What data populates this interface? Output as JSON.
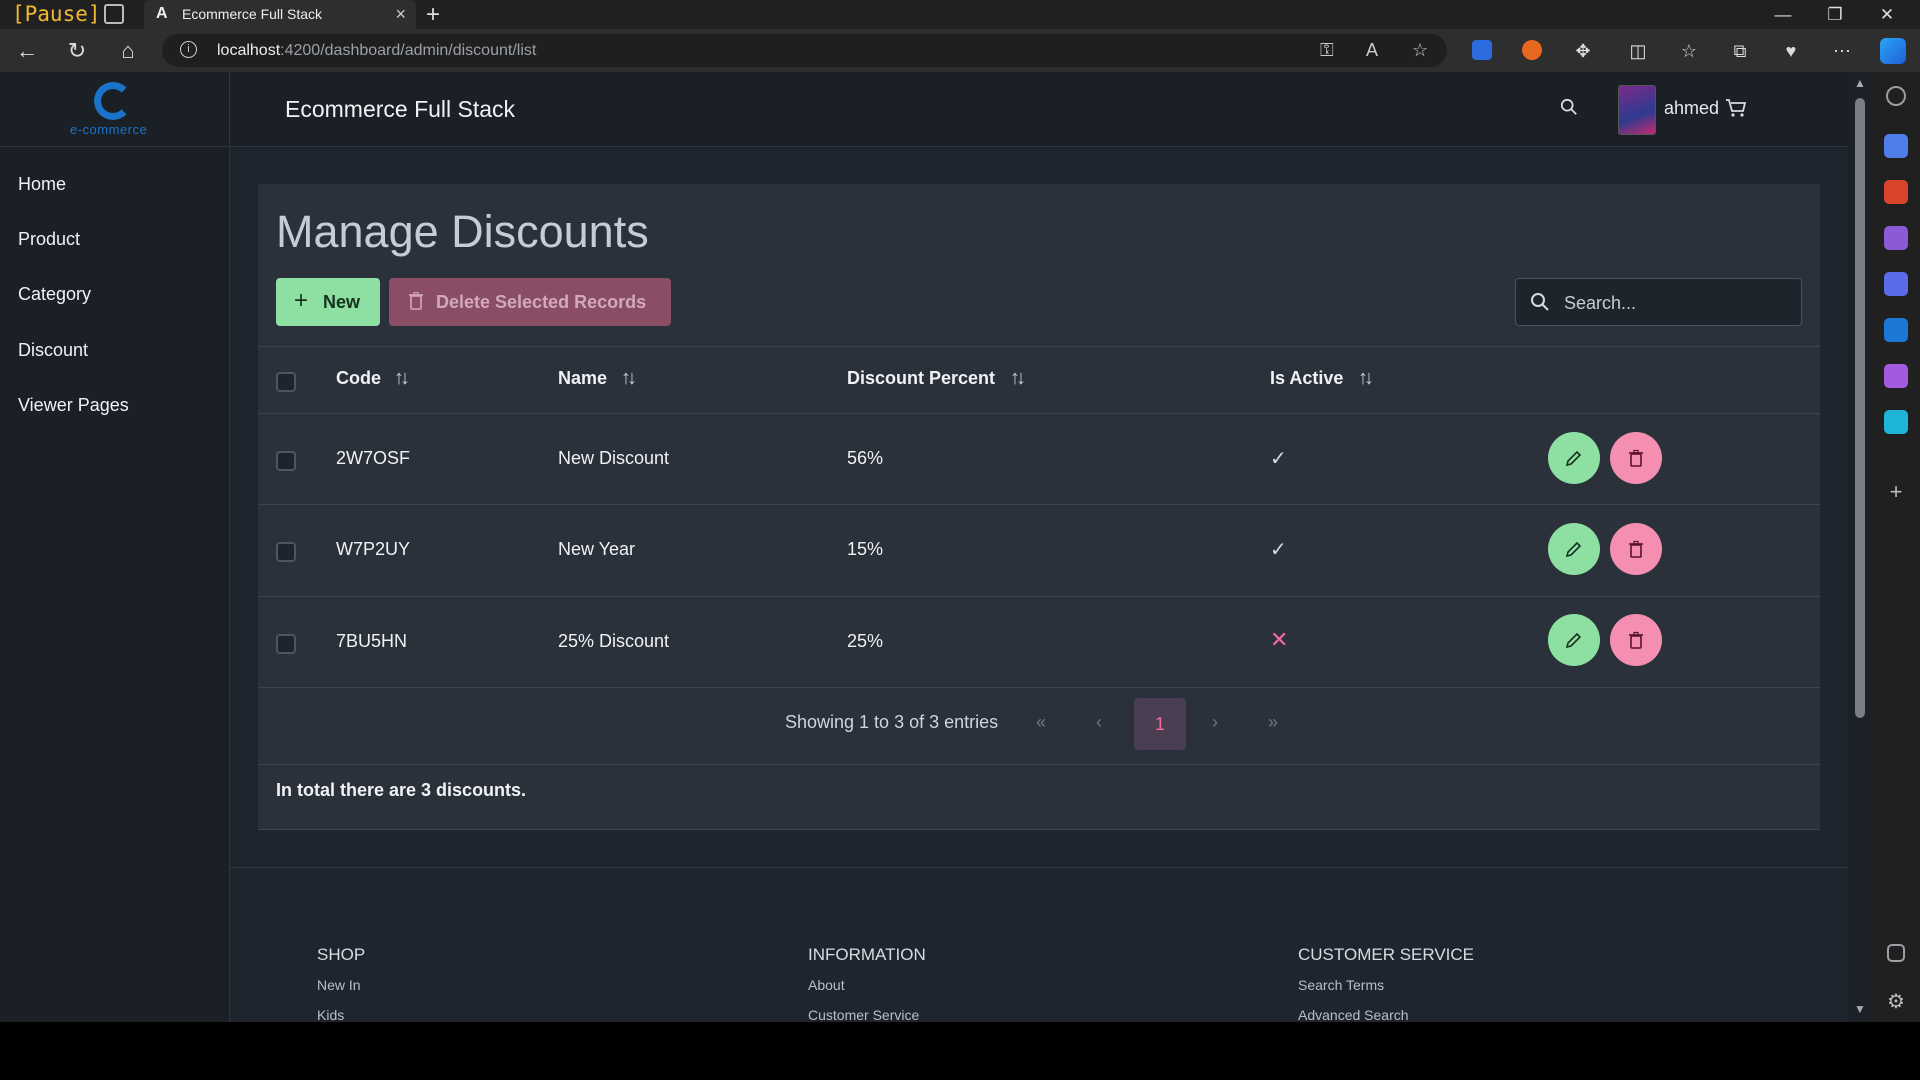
{
  "browser": {
    "pause_label": "[Pause]",
    "tab_title": "Ecommerce Full Stack",
    "tab_icon": "A",
    "url_host": "localhost",
    "url_rest": ":4200/dashboard/admin/discount/list"
  },
  "app": {
    "logo_text": "e-commerce",
    "brand": "Ecommerce Full Stack",
    "username": "ahmed"
  },
  "sidebar": {
    "items": [
      {
        "label": "Home"
      },
      {
        "label": "Product"
      },
      {
        "label": "Category"
      },
      {
        "label": "Discount"
      },
      {
        "label": "Viewer Pages"
      }
    ]
  },
  "page": {
    "title": "Manage Discounts",
    "new_label": "New",
    "delete_selected_label": "Delete Selected Records",
    "search_placeholder": "Search..."
  },
  "table": {
    "columns": [
      "Code",
      "Name",
      "Discount Percent",
      "Is Active"
    ],
    "rows": [
      {
        "code": "2W7OSF",
        "name": "New Discount",
        "percent": "56%",
        "active": true,
        "active_glyph": "✓"
      },
      {
        "code": "W7P2UY",
        "name": "New Year",
        "percent": "15%",
        "active": true,
        "active_glyph": "✓"
      },
      {
        "code": "7BU5HN",
        "name": "25% Discount",
        "percent": "25%",
        "active": false,
        "active_glyph": "✕"
      }
    ]
  },
  "pagination": {
    "summary": "Showing 1 to 3 of 3 entries",
    "first": "«",
    "prev": "‹",
    "current_page": "1",
    "next": "›",
    "last": "»"
  },
  "summary_text": "In total there are 3 discounts.",
  "footer": {
    "columns": [
      {
        "title": "SHOP",
        "links": [
          "New In",
          "Kids"
        ]
      },
      {
        "title": "INFORMATION",
        "links": [
          "About",
          "Customer Service"
        ]
      },
      {
        "title": "CUSTOMER SERVICE",
        "links": [
          "Search Terms",
          "Advanced Search"
        ]
      }
    ]
  },
  "colors": {
    "accent_green": "#8ee0a2",
    "accent_pink": "#f48fb1",
    "card_bg": "#2a313b",
    "page_bg": "#1f252e"
  }
}
